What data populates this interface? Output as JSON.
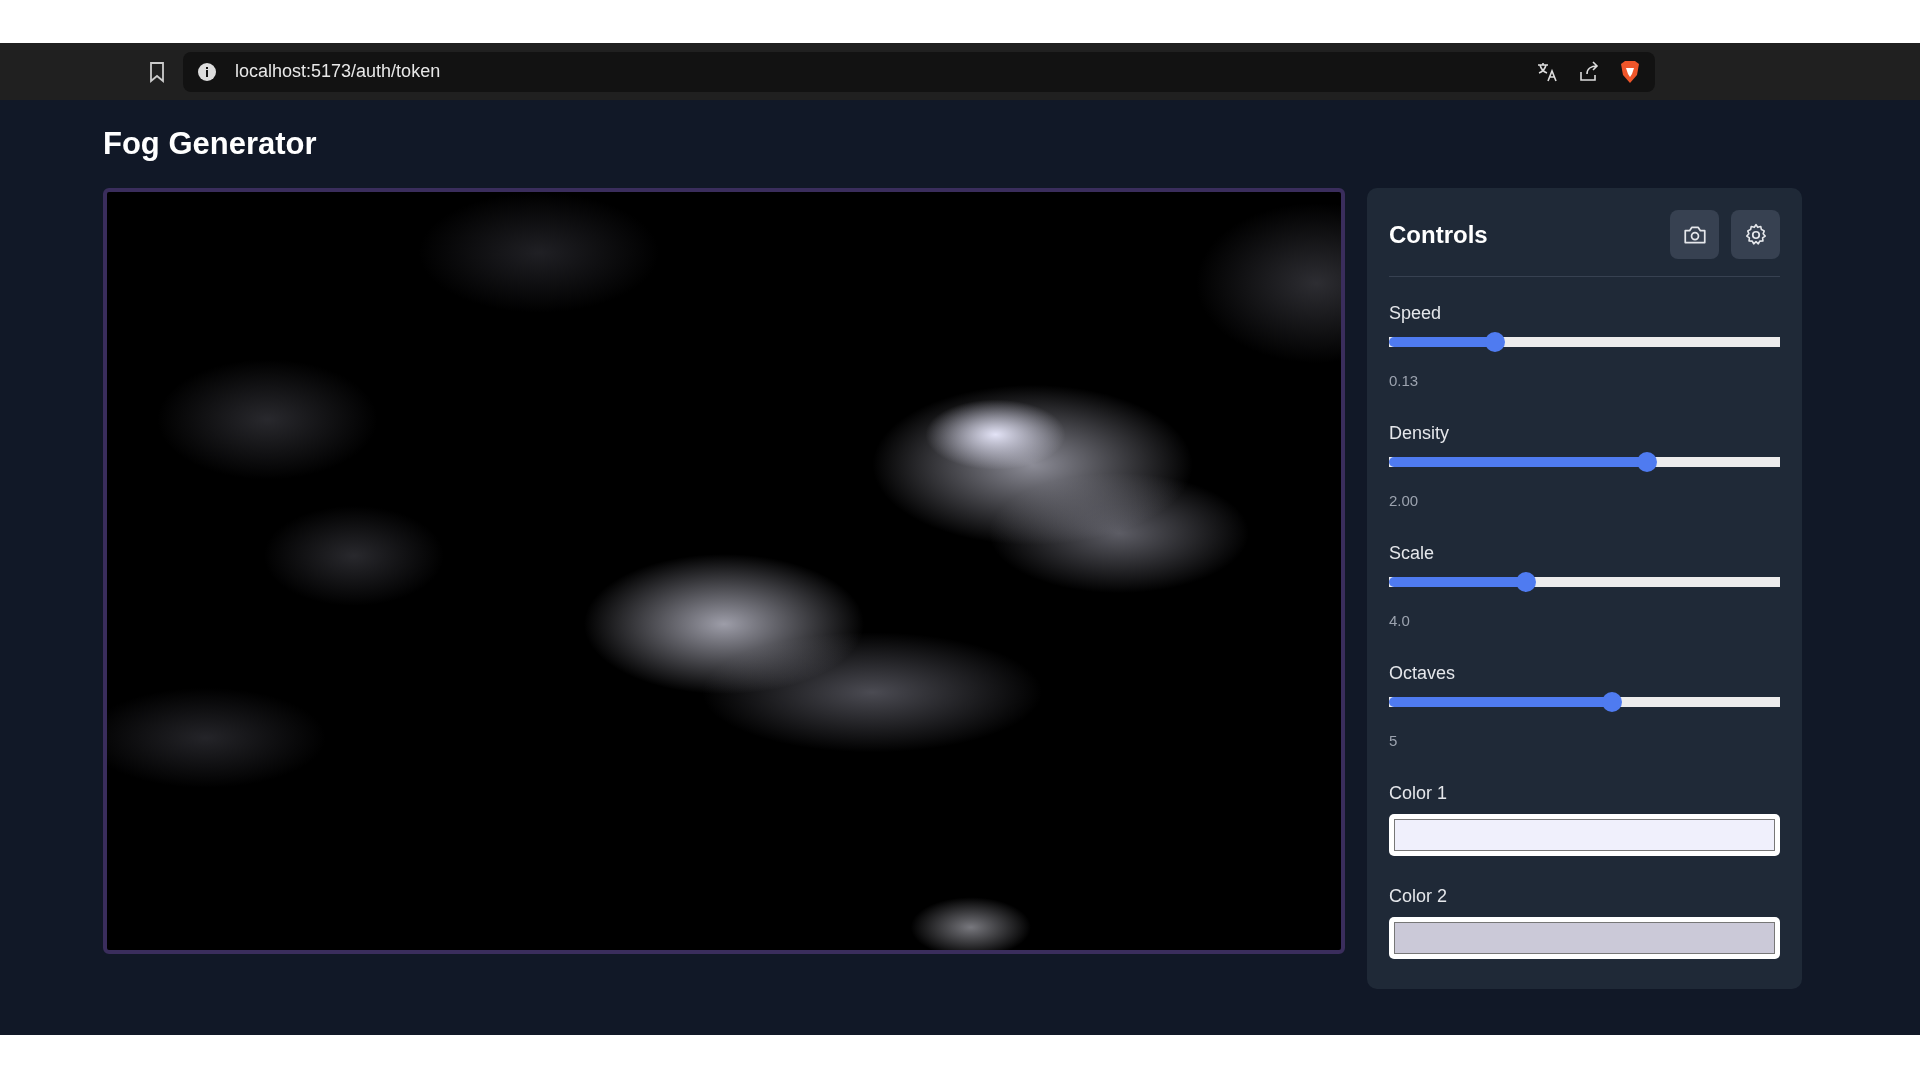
{
  "browser": {
    "url": "localhost:5173/auth/token"
  },
  "page": {
    "title": "Fog Generator"
  },
  "controls": {
    "title": "Controls",
    "sliders": [
      {
        "label": "Speed",
        "level": 0.27,
        "reading": "0.13"
      },
      {
        "label": "Density",
        "level": 0.66,
        "reading": "2.00"
      },
      {
        "label": "Scale",
        "level": 0.35,
        "reading": "4.0"
      },
      {
        "label": "Octaves",
        "level": 0.57,
        "reading": "5"
      }
    ],
    "colors": [
      {
        "label": "Color 1",
        "color": "#f0f0fc"
      },
      {
        "label": "Color 2",
        "color": "#cbc9d8"
      }
    ]
  }
}
